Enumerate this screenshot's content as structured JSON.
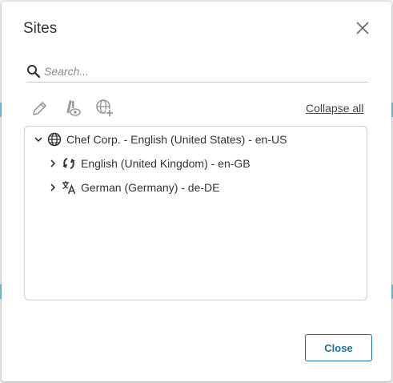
{
  "dialog": {
    "title": "Sites",
    "close_label": "Close"
  },
  "search": {
    "placeholder": "Search..."
  },
  "toolbar": {
    "collapse_all_label": "Collapse all",
    "icons": [
      "edit-icon",
      "site-preview-icon",
      "add-site-icon"
    ]
  },
  "tree": {
    "root": {
      "label": "Chef Corp. - English (United States) - en-US",
      "icon": "globe-icon",
      "expanded": true,
      "children": [
        {
          "label": "English (United Kingdom) - en-GB",
          "icon": "sync-icon",
          "expanded": false
        },
        {
          "label": "German (Germany) - de-DE",
          "icon": "translate-icon",
          "expanded": false
        }
      ]
    }
  },
  "colors": {
    "accent": "#1f6e94",
    "border": "#cfcfcf",
    "icon_muted": "#8a8a8a",
    "text": "#333333"
  }
}
